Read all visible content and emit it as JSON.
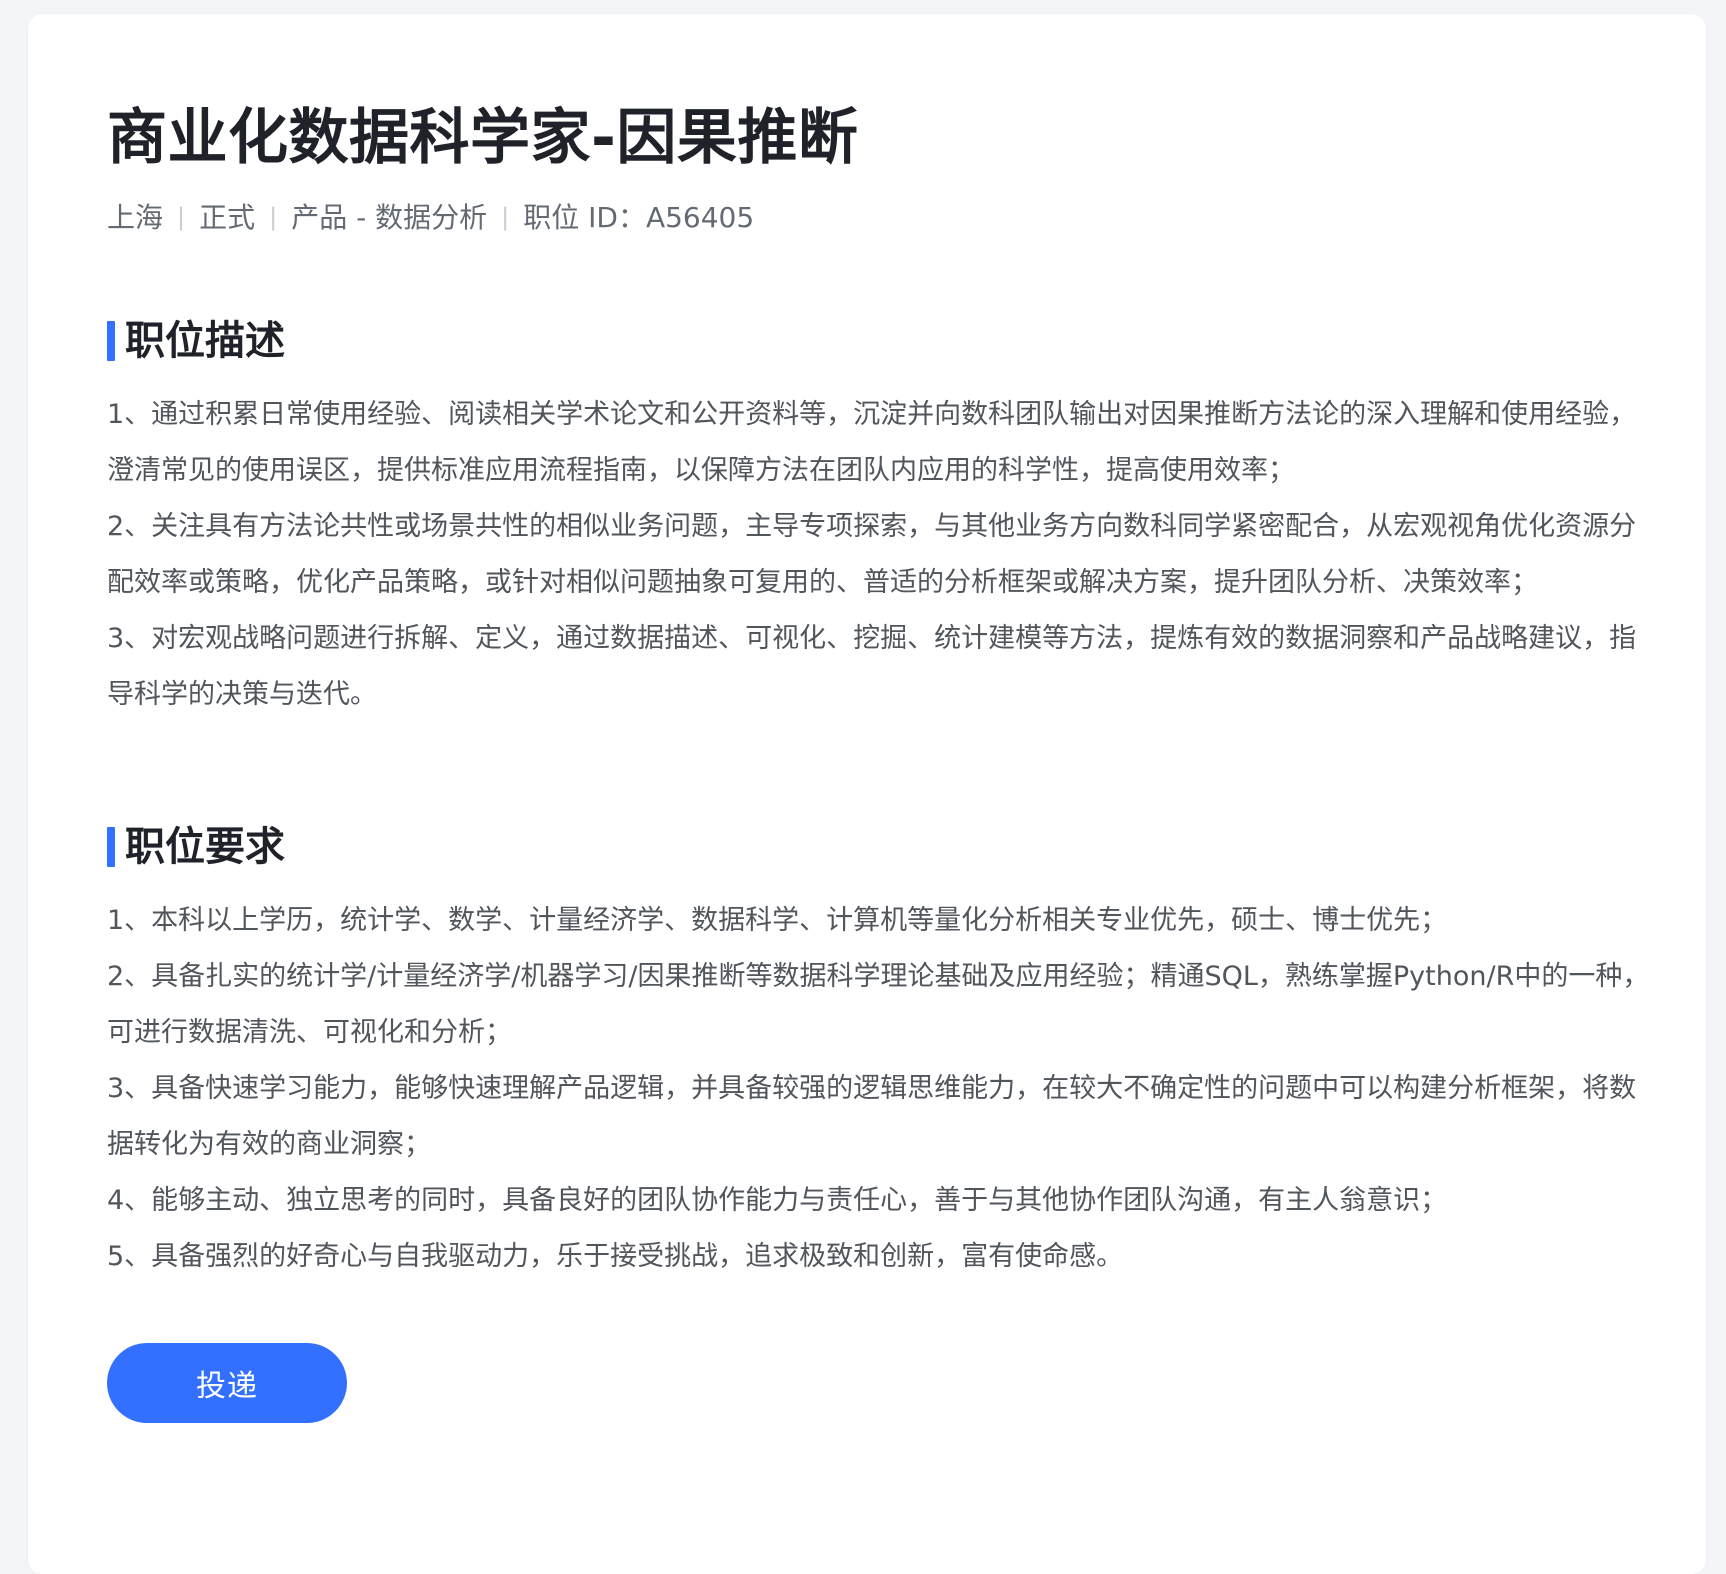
{
  "job": {
    "title": "商业化数据科学家-因果推断",
    "meta": {
      "location": "上海",
      "type": "正式",
      "category": "产品 - 数据分析",
      "job_id": "职位 ID：A56405"
    }
  },
  "sections": {
    "description": {
      "title": "职位描述",
      "items": [
        "1、通过积累日常使用经验、阅读相关学术论文和公开资料等，沉淀并向数科团队输出对因果推断方法论的深入理解和使用经验，澄清常见的使用误区，提供标准应用流程指南，以保障方法在团队内应用的科学性，提高使用效率；",
        "2、关注具有方法论共性或场景共性的相似业务问题，主导专项探索，与其他业务方向数科同学紧密配合，从宏观视角优化资源分配效率或策略，优化产品策略，或针对相似问题抽象可复用的、普适的分析框架或解决方案，提升团队分析、决策效率；",
        "3、对宏观战略问题进行拆解、定义，通过数据描述、可视化、挖掘、统计建模等方法，提炼有效的数据洞察和产品战略建议，指导科学的决策与迭代。"
      ]
    },
    "requirements": {
      "title": "职位要求",
      "items": [
        "1、本科以上学历，统计学、数学、计量经济学、数据科学、计算机等量化分析相关专业优先，硕士、博士优先；",
        "2、具备扎实的统计学/计量经济学/机器学习/因果推断等数据科学理论基础及应用经验；精通SQL，熟练掌握Python/R中的一种，可进行数据清洗、可视化和分析；",
        "3、具备快速学习能力，能够快速理解产品逻辑，并具备较强的逻辑思维能力，在较大不确定性的问题中可以构建分析框架，将数据转化为有效的商业洞察；",
        "4、能够主动、独立思考的同时，具备良好的团队协作能力与责任心，善于与其他协作团队沟通，有主人翁意识；",
        "5、具备强烈的好奇心与自我驱动力，乐于接受挑战，追求极致和创新，富有使命感。"
      ]
    }
  },
  "actions": {
    "apply_label": "投递"
  },
  "colors": {
    "accent": "#3370ff",
    "title": "#1f2329",
    "body": "#51565d",
    "meta": "#646a73"
  }
}
